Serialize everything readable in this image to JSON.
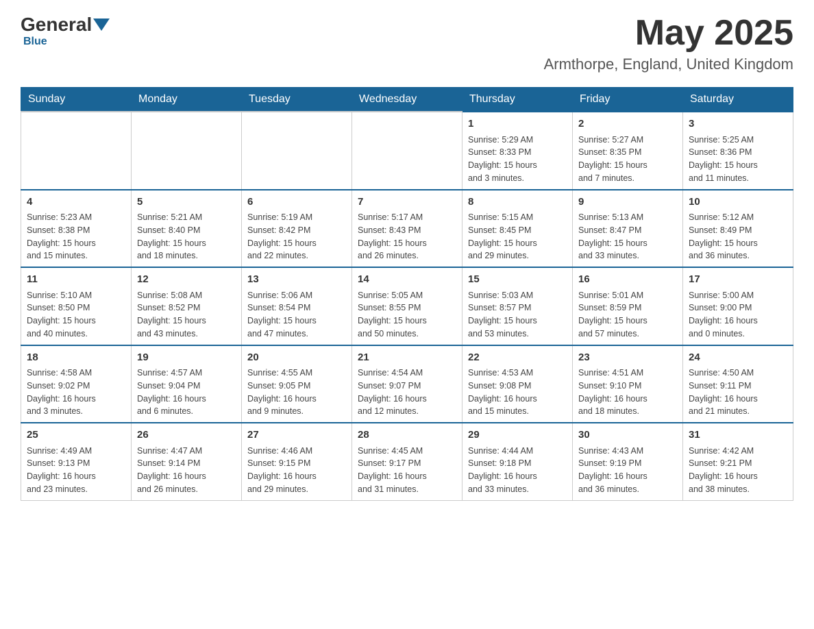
{
  "header": {
    "logo_general": "General",
    "logo_blue": "Blue",
    "month_title": "May 2025",
    "location": "Armthorpe, England, United Kingdom"
  },
  "weekdays": [
    "Sunday",
    "Monday",
    "Tuesday",
    "Wednesday",
    "Thursday",
    "Friday",
    "Saturday"
  ],
  "weeks": [
    [
      {
        "day": "",
        "info": ""
      },
      {
        "day": "",
        "info": ""
      },
      {
        "day": "",
        "info": ""
      },
      {
        "day": "",
        "info": ""
      },
      {
        "day": "1",
        "info": "Sunrise: 5:29 AM\nSunset: 8:33 PM\nDaylight: 15 hours\nand 3 minutes."
      },
      {
        "day": "2",
        "info": "Sunrise: 5:27 AM\nSunset: 8:35 PM\nDaylight: 15 hours\nand 7 minutes."
      },
      {
        "day": "3",
        "info": "Sunrise: 5:25 AM\nSunset: 8:36 PM\nDaylight: 15 hours\nand 11 minutes."
      }
    ],
    [
      {
        "day": "4",
        "info": "Sunrise: 5:23 AM\nSunset: 8:38 PM\nDaylight: 15 hours\nand 15 minutes."
      },
      {
        "day": "5",
        "info": "Sunrise: 5:21 AM\nSunset: 8:40 PM\nDaylight: 15 hours\nand 18 minutes."
      },
      {
        "day": "6",
        "info": "Sunrise: 5:19 AM\nSunset: 8:42 PM\nDaylight: 15 hours\nand 22 minutes."
      },
      {
        "day": "7",
        "info": "Sunrise: 5:17 AM\nSunset: 8:43 PM\nDaylight: 15 hours\nand 26 minutes."
      },
      {
        "day": "8",
        "info": "Sunrise: 5:15 AM\nSunset: 8:45 PM\nDaylight: 15 hours\nand 29 minutes."
      },
      {
        "day": "9",
        "info": "Sunrise: 5:13 AM\nSunset: 8:47 PM\nDaylight: 15 hours\nand 33 minutes."
      },
      {
        "day": "10",
        "info": "Sunrise: 5:12 AM\nSunset: 8:49 PM\nDaylight: 15 hours\nand 36 minutes."
      }
    ],
    [
      {
        "day": "11",
        "info": "Sunrise: 5:10 AM\nSunset: 8:50 PM\nDaylight: 15 hours\nand 40 minutes."
      },
      {
        "day": "12",
        "info": "Sunrise: 5:08 AM\nSunset: 8:52 PM\nDaylight: 15 hours\nand 43 minutes."
      },
      {
        "day": "13",
        "info": "Sunrise: 5:06 AM\nSunset: 8:54 PM\nDaylight: 15 hours\nand 47 minutes."
      },
      {
        "day": "14",
        "info": "Sunrise: 5:05 AM\nSunset: 8:55 PM\nDaylight: 15 hours\nand 50 minutes."
      },
      {
        "day": "15",
        "info": "Sunrise: 5:03 AM\nSunset: 8:57 PM\nDaylight: 15 hours\nand 53 minutes."
      },
      {
        "day": "16",
        "info": "Sunrise: 5:01 AM\nSunset: 8:59 PM\nDaylight: 15 hours\nand 57 minutes."
      },
      {
        "day": "17",
        "info": "Sunrise: 5:00 AM\nSunset: 9:00 PM\nDaylight: 16 hours\nand 0 minutes."
      }
    ],
    [
      {
        "day": "18",
        "info": "Sunrise: 4:58 AM\nSunset: 9:02 PM\nDaylight: 16 hours\nand 3 minutes."
      },
      {
        "day": "19",
        "info": "Sunrise: 4:57 AM\nSunset: 9:04 PM\nDaylight: 16 hours\nand 6 minutes."
      },
      {
        "day": "20",
        "info": "Sunrise: 4:55 AM\nSunset: 9:05 PM\nDaylight: 16 hours\nand 9 minutes."
      },
      {
        "day": "21",
        "info": "Sunrise: 4:54 AM\nSunset: 9:07 PM\nDaylight: 16 hours\nand 12 minutes."
      },
      {
        "day": "22",
        "info": "Sunrise: 4:53 AM\nSunset: 9:08 PM\nDaylight: 16 hours\nand 15 minutes."
      },
      {
        "day": "23",
        "info": "Sunrise: 4:51 AM\nSunset: 9:10 PM\nDaylight: 16 hours\nand 18 minutes."
      },
      {
        "day": "24",
        "info": "Sunrise: 4:50 AM\nSunset: 9:11 PM\nDaylight: 16 hours\nand 21 minutes."
      }
    ],
    [
      {
        "day": "25",
        "info": "Sunrise: 4:49 AM\nSunset: 9:13 PM\nDaylight: 16 hours\nand 23 minutes."
      },
      {
        "day": "26",
        "info": "Sunrise: 4:47 AM\nSunset: 9:14 PM\nDaylight: 16 hours\nand 26 minutes."
      },
      {
        "day": "27",
        "info": "Sunrise: 4:46 AM\nSunset: 9:15 PM\nDaylight: 16 hours\nand 29 minutes."
      },
      {
        "day": "28",
        "info": "Sunrise: 4:45 AM\nSunset: 9:17 PM\nDaylight: 16 hours\nand 31 minutes."
      },
      {
        "day": "29",
        "info": "Sunrise: 4:44 AM\nSunset: 9:18 PM\nDaylight: 16 hours\nand 33 minutes."
      },
      {
        "day": "30",
        "info": "Sunrise: 4:43 AM\nSunset: 9:19 PM\nDaylight: 16 hours\nand 36 minutes."
      },
      {
        "day": "31",
        "info": "Sunrise: 4:42 AM\nSunset: 9:21 PM\nDaylight: 16 hours\nand 38 minutes."
      }
    ]
  ]
}
